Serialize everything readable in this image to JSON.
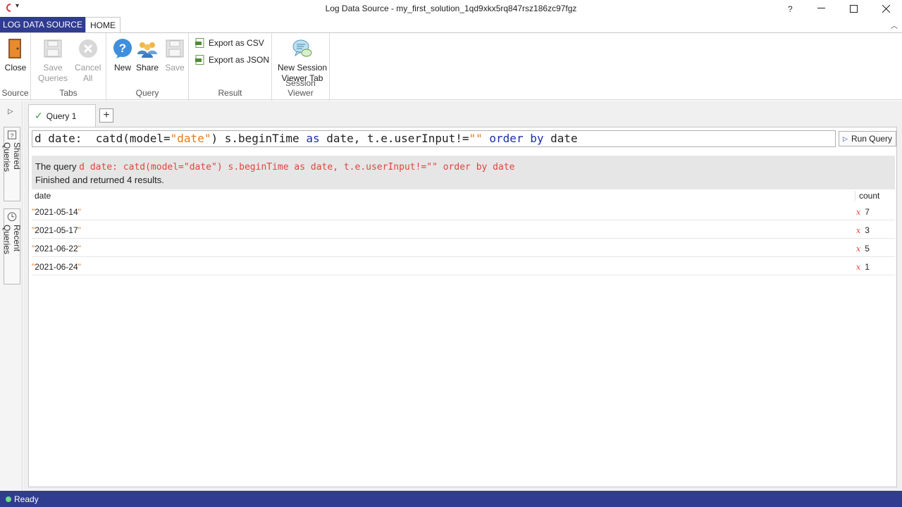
{
  "window": {
    "title": "Log Data Source - my_first_solution_1qd9xkx5rq847rsz186zc97fgz",
    "help": "?",
    "minimize": "—",
    "maximize": "☐",
    "close": "✕"
  },
  "ribbon_tabs": {
    "context_tab": "LOG DATA SOURCE",
    "home_tab": "HOME"
  },
  "ribbon": {
    "groups": {
      "source": "Source",
      "tabs": "Tabs",
      "query": "Query",
      "result": "Result",
      "session_viewer": "Session Viewer"
    },
    "close": "Close",
    "save_queries_1": "Save",
    "save_queries_2": "Queries",
    "cancel_all_1": "Cancel",
    "cancel_all_2": "All",
    "new": "New",
    "share": "Share",
    "save": "Save",
    "export_csv": "Export as CSV",
    "export_json": "Export as JSON",
    "new_session_1": "New Session",
    "new_session_2": "Viewer Tab"
  },
  "rail": {
    "shared_queries": "Shared Queries",
    "recent_queries": "Recent Queries"
  },
  "doc_tabs": {
    "query_tab": "Query 1",
    "add": "+"
  },
  "editor": {
    "seg1": "d date:  catd(model=",
    "seg2": "\"date\"",
    "seg3": ") s.beginTime ",
    "seg4": "as",
    "seg5": " date, t.e.userInput!=",
    "seg6": "\"\"",
    "seg7": " ",
    "seg8": "order",
    "seg9": " ",
    "seg10": "by",
    "seg11": " date",
    "run_label": "Run Query"
  },
  "result": {
    "prefix": "The query",
    "query_text": "d date:  catd(model=\"date\") s.beginTime as date, t.e.userInput!=\"\" order by date",
    "status": "Finished and returned 4 results.",
    "columns": [
      "date",
      "count"
    ],
    "rows": [
      {
        "date": "2021-05-14",
        "count": "7"
      },
      {
        "date": "2021-05-17",
        "count": "3"
      },
      {
        "date": "2021-06-22",
        "count": "5"
      },
      {
        "date": "2021-06-24",
        "count": "1"
      }
    ],
    "quote": "\"",
    "x_glyph": "x"
  },
  "status": {
    "text": "Ready"
  }
}
